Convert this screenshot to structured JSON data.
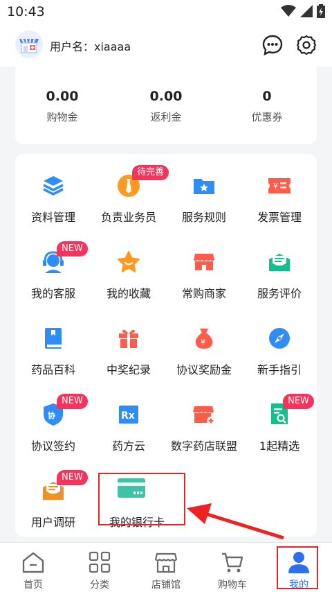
{
  "status": {
    "time": "10:43"
  },
  "header": {
    "username": "用户名：xiaaaa"
  },
  "stats": [
    {
      "value": "0.00",
      "label": "购物金"
    },
    {
      "value": "0.00",
      "label": "返利金"
    },
    {
      "value": "0",
      "label": "优惠券"
    }
  ],
  "menu": [
    {
      "label": "资料管理",
      "icon": "layers-icon"
    },
    {
      "label": "负责业务员",
      "icon": "tie-icon",
      "badge": "待完善"
    },
    {
      "label": "服务规则",
      "icon": "folder-star-icon"
    },
    {
      "label": "发票管理",
      "icon": "invoice-icon"
    },
    {
      "label": "我的客服",
      "icon": "headset-icon",
      "badge": "NEW"
    },
    {
      "label": "我的收藏",
      "icon": "star-icon"
    },
    {
      "label": "常购商家",
      "icon": "shop-icon"
    },
    {
      "label": "服务评价",
      "icon": "mail-review-icon"
    },
    {
      "label": "药品百科",
      "icon": "book-icon"
    },
    {
      "label": "中奖纪录",
      "icon": "gift-icon"
    },
    {
      "label": "协议奖励金",
      "icon": "money-bag-icon"
    },
    {
      "label": "新手指引",
      "icon": "compass-icon"
    },
    {
      "label": "协议签约",
      "icon": "shield-agreement-icon",
      "badge": "NEW"
    },
    {
      "label": "药方云",
      "icon": "rx-icon"
    },
    {
      "label": "数字药店联盟",
      "icon": "store-plus-icon"
    },
    {
      "label": "1起精选",
      "icon": "doc-search-icon",
      "badge": "NEW"
    },
    {
      "label": "用户调研",
      "icon": "survey-envelope-icon",
      "badge": "NEW"
    },
    {
      "label": "我的银行卡",
      "icon": "bank-card-icon"
    }
  ],
  "tabs": [
    {
      "label": "首页",
      "icon": "home-icon"
    },
    {
      "label": "分类",
      "icon": "grid-icon"
    },
    {
      "label": "店铺馆",
      "icon": "storefront-icon"
    },
    {
      "label": "购物车",
      "icon": "cart-icon"
    },
    {
      "label": "我的",
      "icon": "user-icon",
      "active": true
    }
  ],
  "colors": {
    "accent": "#2e6ff2",
    "badge": "#f5335d",
    "highlight": "#e22222"
  }
}
